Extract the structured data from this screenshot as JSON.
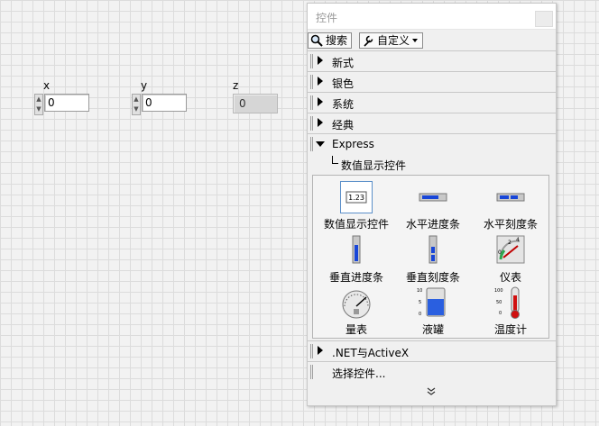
{
  "front_panel": {
    "controls": [
      {
        "label": "x",
        "value": "0"
      },
      {
        "label": "y",
        "value": "0"
      }
    ],
    "indicator": {
      "label": "z",
      "value": "0"
    }
  },
  "palette": {
    "title": "控件",
    "search_label": "搜索",
    "customize_label": "自定义",
    "categories": [
      "新式",
      "银色",
      "系统",
      "经典"
    ],
    "expanded_category": "Express",
    "subcategory": "数值显示控件",
    "items": [
      {
        "label": "数值显示控件",
        "icon": "numeric-display-icon"
      },
      {
        "label": "水平进度条",
        "icon": "horizontal-progress-icon"
      },
      {
        "label": "水平刻度条",
        "icon": "horizontal-slide-icon"
      },
      {
        "label": "垂直进度条",
        "icon": "vertical-progress-icon"
      },
      {
        "label": "垂直刻度条",
        "icon": "vertical-slide-icon"
      },
      {
        "label": "仪表",
        "icon": "gauge-icon"
      },
      {
        "label": "量表",
        "icon": "meter-icon"
      },
      {
        "label": "液罐",
        "icon": "tank-icon"
      },
      {
        "label": "温度计",
        "icon": "thermometer-icon"
      }
    ],
    "numeric_icon_text": "1.23",
    "tank_scale": [
      "10",
      "5",
      "0"
    ],
    "thermo_scale": [
      "100",
      "50",
      "0"
    ],
    "gauge_scale": [
      "0",
      "2",
      "4"
    ],
    "more_categories": [
      ".NET与ActiveX",
      "选择控件..."
    ]
  }
}
